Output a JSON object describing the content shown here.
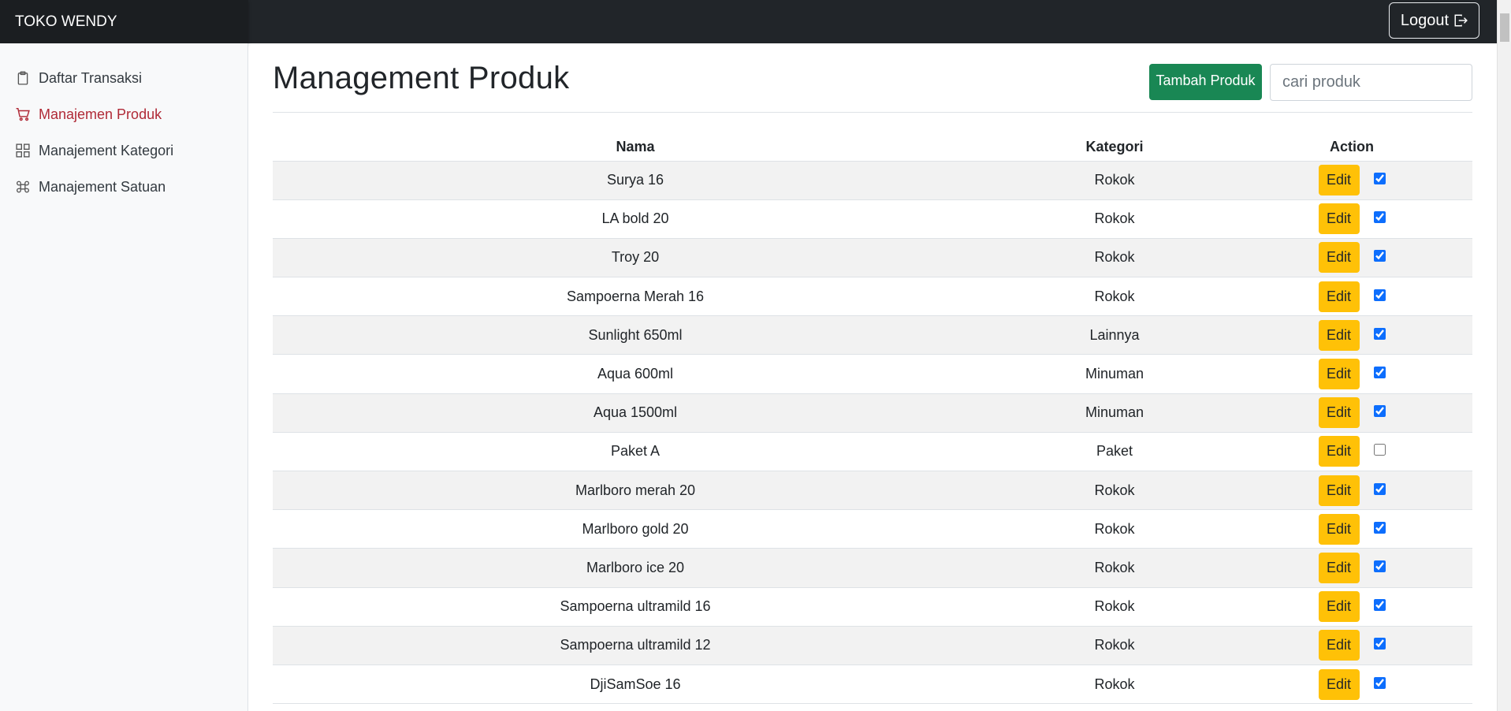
{
  "brand": "TOKO WENDY",
  "header": {
    "logout_label": "Logout"
  },
  "sidebar": {
    "items": [
      {
        "label": "Daftar Transaksi",
        "icon": "clipboard-icon",
        "active": false
      },
      {
        "label": "Manajemen Produk",
        "icon": "cart-icon",
        "active": true
      },
      {
        "label": "Manajement Kategori",
        "icon": "grid-icon",
        "active": false
      },
      {
        "label": "Manajement Satuan",
        "icon": "command-icon",
        "active": false
      }
    ]
  },
  "main": {
    "title": "Management Produk",
    "add_button": "Tambah Produk",
    "search_placeholder": "cari produk",
    "columns": [
      "Nama",
      "Kategori",
      "Action"
    ],
    "edit_label": "Edit",
    "rows": [
      {
        "nama": "Surya 16",
        "kategori": "Rokok",
        "checked": true
      },
      {
        "nama": "LA bold 20",
        "kategori": "Rokok",
        "checked": true
      },
      {
        "nama": "Troy 20",
        "kategori": "Rokok",
        "checked": true
      },
      {
        "nama": "Sampoerna Merah 16",
        "kategori": "Rokok",
        "checked": true
      },
      {
        "nama": "Sunlight 650ml",
        "kategori": "Lainnya",
        "checked": true
      },
      {
        "nama": "Aqua 600ml",
        "kategori": "Minuman",
        "checked": true
      },
      {
        "nama": "Aqua 1500ml",
        "kategori": "Minuman",
        "checked": true
      },
      {
        "nama": "Paket A",
        "kategori": "Paket",
        "checked": false
      },
      {
        "nama": "Marlboro merah 20",
        "kategori": "Rokok",
        "checked": true
      },
      {
        "nama": "Marlboro gold 20",
        "kategori": "Rokok",
        "checked": true
      },
      {
        "nama": "Marlboro ice 20",
        "kategori": "Rokok",
        "checked": true
      },
      {
        "nama": "Sampoerna ultramild 16",
        "kategori": "Rokok",
        "checked": true
      },
      {
        "nama": "Sampoerna ultramild 12",
        "kategori": "Rokok",
        "checked": true
      },
      {
        "nama": "DjiSamSoe 16",
        "kategori": "Rokok",
        "checked": true
      }
    ]
  },
  "colors": {
    "navbar": "#212529",
    "active_nav": "#b02a37",
    "add_button": "#198754",
    "edit_button": "#ffc107",
    "stripe": "#f2f2f2"
  }
}
